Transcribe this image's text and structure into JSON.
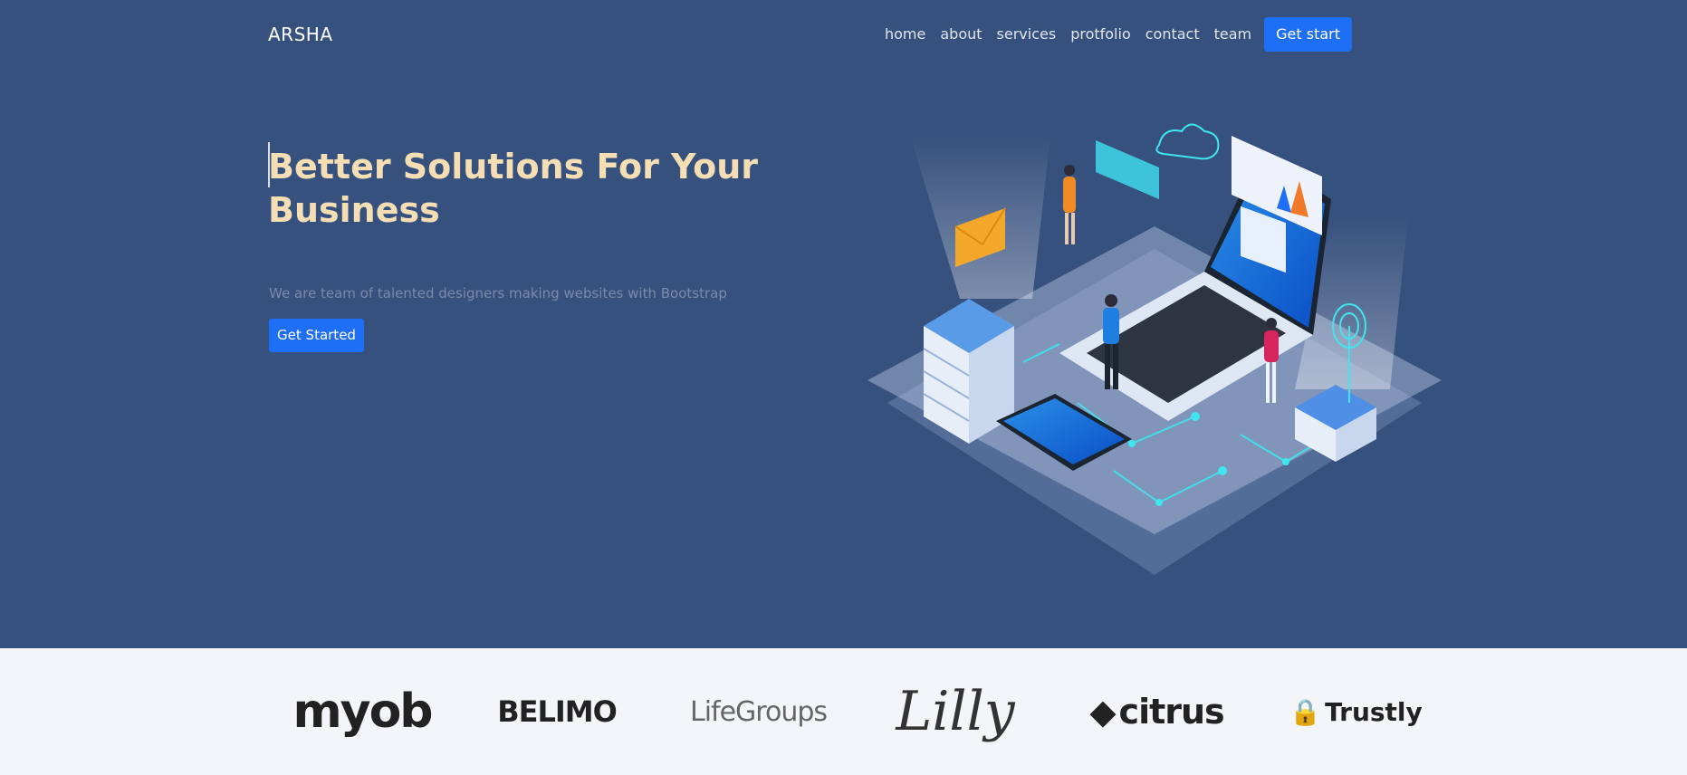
{
  "brand": {
    "name": "ARSHA"
  },
  "nav": {
    "items": [
      "home",
      "about",
      "services",
      "protfolio",
      "contact",
      "team"
    ],
    "cta_label": "Get start"
  },
  "hero": {
    "title": "Better Solutions For Your Business",
    "subtitle": "We are team of talented designers making websites with Bootstrap",
    "cta_label": "Get Started"
  },
  "clients": {
    "logos": [
      "myob",
      "BELIMO",
      "LifeGroups",
      "Lilly",
      "citrus",
      "Trustly"
    ]
  },
  "colors": {
    "background": "#37517e",
    "accent": "#1e6ff5",
    "title": "#f6deb4",
    "clients_bg": "#f4f5f9"
  }
}
